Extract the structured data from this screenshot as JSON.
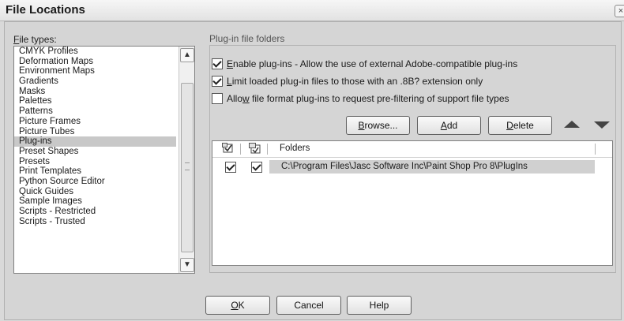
{
  "window": {
    "title": "File Locations",
    "close_glyph": "×"
  },
  "file_types": {
    "label": "File types:",
    "items": [
      "CMYK Profiles",
      "Deformation Maps",
      "Environment Maps",
      "Gradients",
      "Masks",
      "Palettes",
      "Patterns",
      "Picture Frames",
      "Picture Tubes",
      "Plug-ins",
      "Preset Shapes",
      "Presets",
      "Print Templates",
      "Python Source Editor",
      "Quick Guides",
      "Sample Images",
      "Scripts - Restricted",
      "Scripts - Trusted"
    ],
    "selected": "Plug-ins"
  },
  "plugin": {
    "group_label": "Plug-in file folders",
    "options": [
      {
        "label": "Enable plug-ins - Allow the use of external Adobe-compatible plug-ins",
        "checked": true
      },
      {
        "label": "Limit loaded plug-in files to those with an .8B? extension only",
        "checked": true
      },
      {
        "label": "Allow file format plug-ins to request pre-filtering of support file types",
        "checked": false
      }
    ],
    "buttons": {
      "browse": "Browse...",
      "add": "Add",
      "delete": "Delete"
    },
    "table": {
      "header_folders": "Folders",
      "rows": [
        {
          "enabled": true,
          "subfolders": true,
          "path": "C:\\Program Files\\Jasc Software Inc\\Paint Shop Pro 8\\PlugIns"
        }
      ]
    }
  },
  "footer": {
    "ok": "OK",
    "cancel": "Cancel",
    "help": "Help"
  }
}
